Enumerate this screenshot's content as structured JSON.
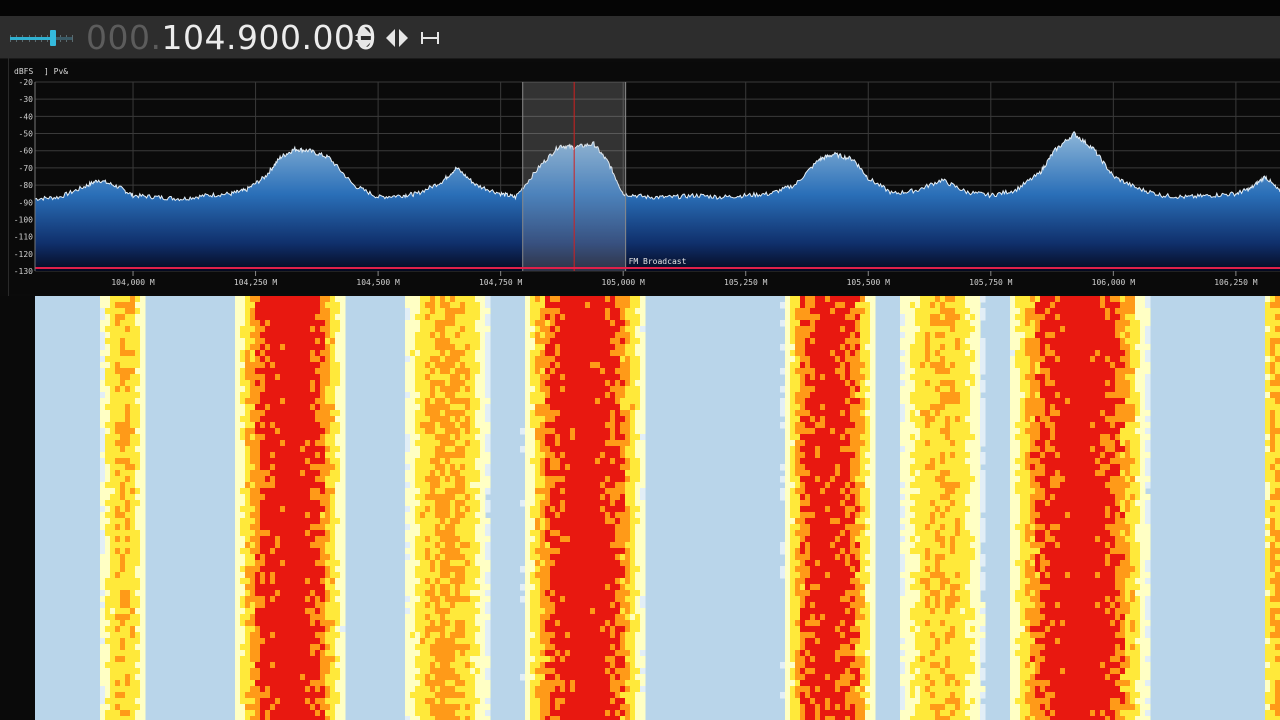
{
  "toolbar": {
    "frequency_dim": "000.",
    "frequency_main": "104.900.000",
    "volume_level": 0.7
  },
  "spectrum": {
    "db_label": "dBFS",
    "mode_label": "] Pv&",
    "bandplan_label": "FM Broadcast",
    "db_ticks": [
      "-20",
      "-30",
      "-40",
      "-50",
      "-60",
      "-70",
      "-80",
      "-90",
      "-100",
      "-110",
      "-120",
      "-130"
    ],
    "freq_ticks": [
      "104,000 M",
      "104,250 M",
      "104,500 M",
      "104,750 M",
      "105,000 M",
      "105,250 M",
      "105,500 M",
      "105,750 M",
      "106,000 M",
      "106,250 M"
    ]
  },
  "chart_data": {
    "type": "area",
    "title": "",
    "xlabel": "",
    "ylabel": "dBFS",
    "ylim": [
      -130,
      -20
    ],
    "xlim_mhz": [
      103.8,
      106.34
    ],
    "tuned_frequency_mhz": 104.9,
    "filter_band_mhz": [
      104.795,
      105.005
    ],
    "grid": true,
    "series": [
      {
        "x_mhz": [
          103.8,
          103.85,
          103.9,
          103.93,
          103.97,
          104.0,
          104.05,
          104.1,
          104.15,
          104.2,
          104.23,
          104.27,
          104.3,
          104.33,
          104.36,
          104.4,
          104.45,
          104.5,
          104.55,
          104.58,
          104.63,
          104.66,
          104.7,
          104.75,
          104.78,
          104.83,
          104.87,
          104.9,
          104.94,
          104.97,
          105.0,
          105.05,
          105.1,
          105.15,
          105.2,
          105.25,
          105.3,
          105.35,
          105.4,
          105.43,
          105.47,
          105.5,
          105.55,
          105.6,
          105.65,
          105.7,
          105.75,
          105.8,
          105.85,
          105.88,
          105.92,
          105.96,
          106.0,
          106.05,
          106.1,
          106.15,
          106.2,
          106.25,
          106.28,
          106.31,
          106.34
        ],
        "y_dbfs": [
          -88,
          -87,
          -81,
          -77,
          -81,
          -86,
          -87,
          -88,
          -86,
          -85,
          -83,
          -75,
          -64,
          -59,
          -60,
          -64,
          -80,
          -87,
          -86,
          -85,
          -78,
          -70,
          -80,
          -85,
          -87,
          -69,
          -57,
          -58,
          -56,
          -67,
          -85,
          -87,
          -87,
          -86,
          -87,
          -86,
          -85,
          -80,
          -65,
          -62,
          -65,
          -76,
          -85,
          -83,
          -77,
          -84,
          -86,
          -83,
          -73,
          -60,
          -50,
          -59,
          -75,
          -82,
          -86,
          -87,
          -86,
          -85,
          -82,
          -75,
          -84
        ]
      }
    ]
  },
  "waterfall": {
    "colormap": [
      "#b9d5ea",
      "#e2eef6",
      "#ffffc4",
      "#ffe93a",
      "#ff9a18",
      "#e81810"
    ],
    "bands_mhz": [
      {
        "center": 103.98,
        "width": 0.08,
        "level": 0.55
      },
      {
        "center": 104.32,
        "width": 0.19,
        "level": 1.0
      },
      {
        "center": 104.64,
        "width": 0.15,
        "level": 0.62
      },
      {
        "center": 104.92,
        "width": 0.21,
        "level": 1.0
      },
      {
        "center": 105.42,
        "width": 0.16,
        "level": 0.95
      },
      {
        "center": 105.65,
        "width": 0.15,
        "level": 0.55
      },
      {
        "center": 105.93,
        "width": 0.24,
        "level": 1.0
      },
      {
        "center": 106.33,
        "width": 0.04,
        "level": 0.6
      }
    ]
  }
}
